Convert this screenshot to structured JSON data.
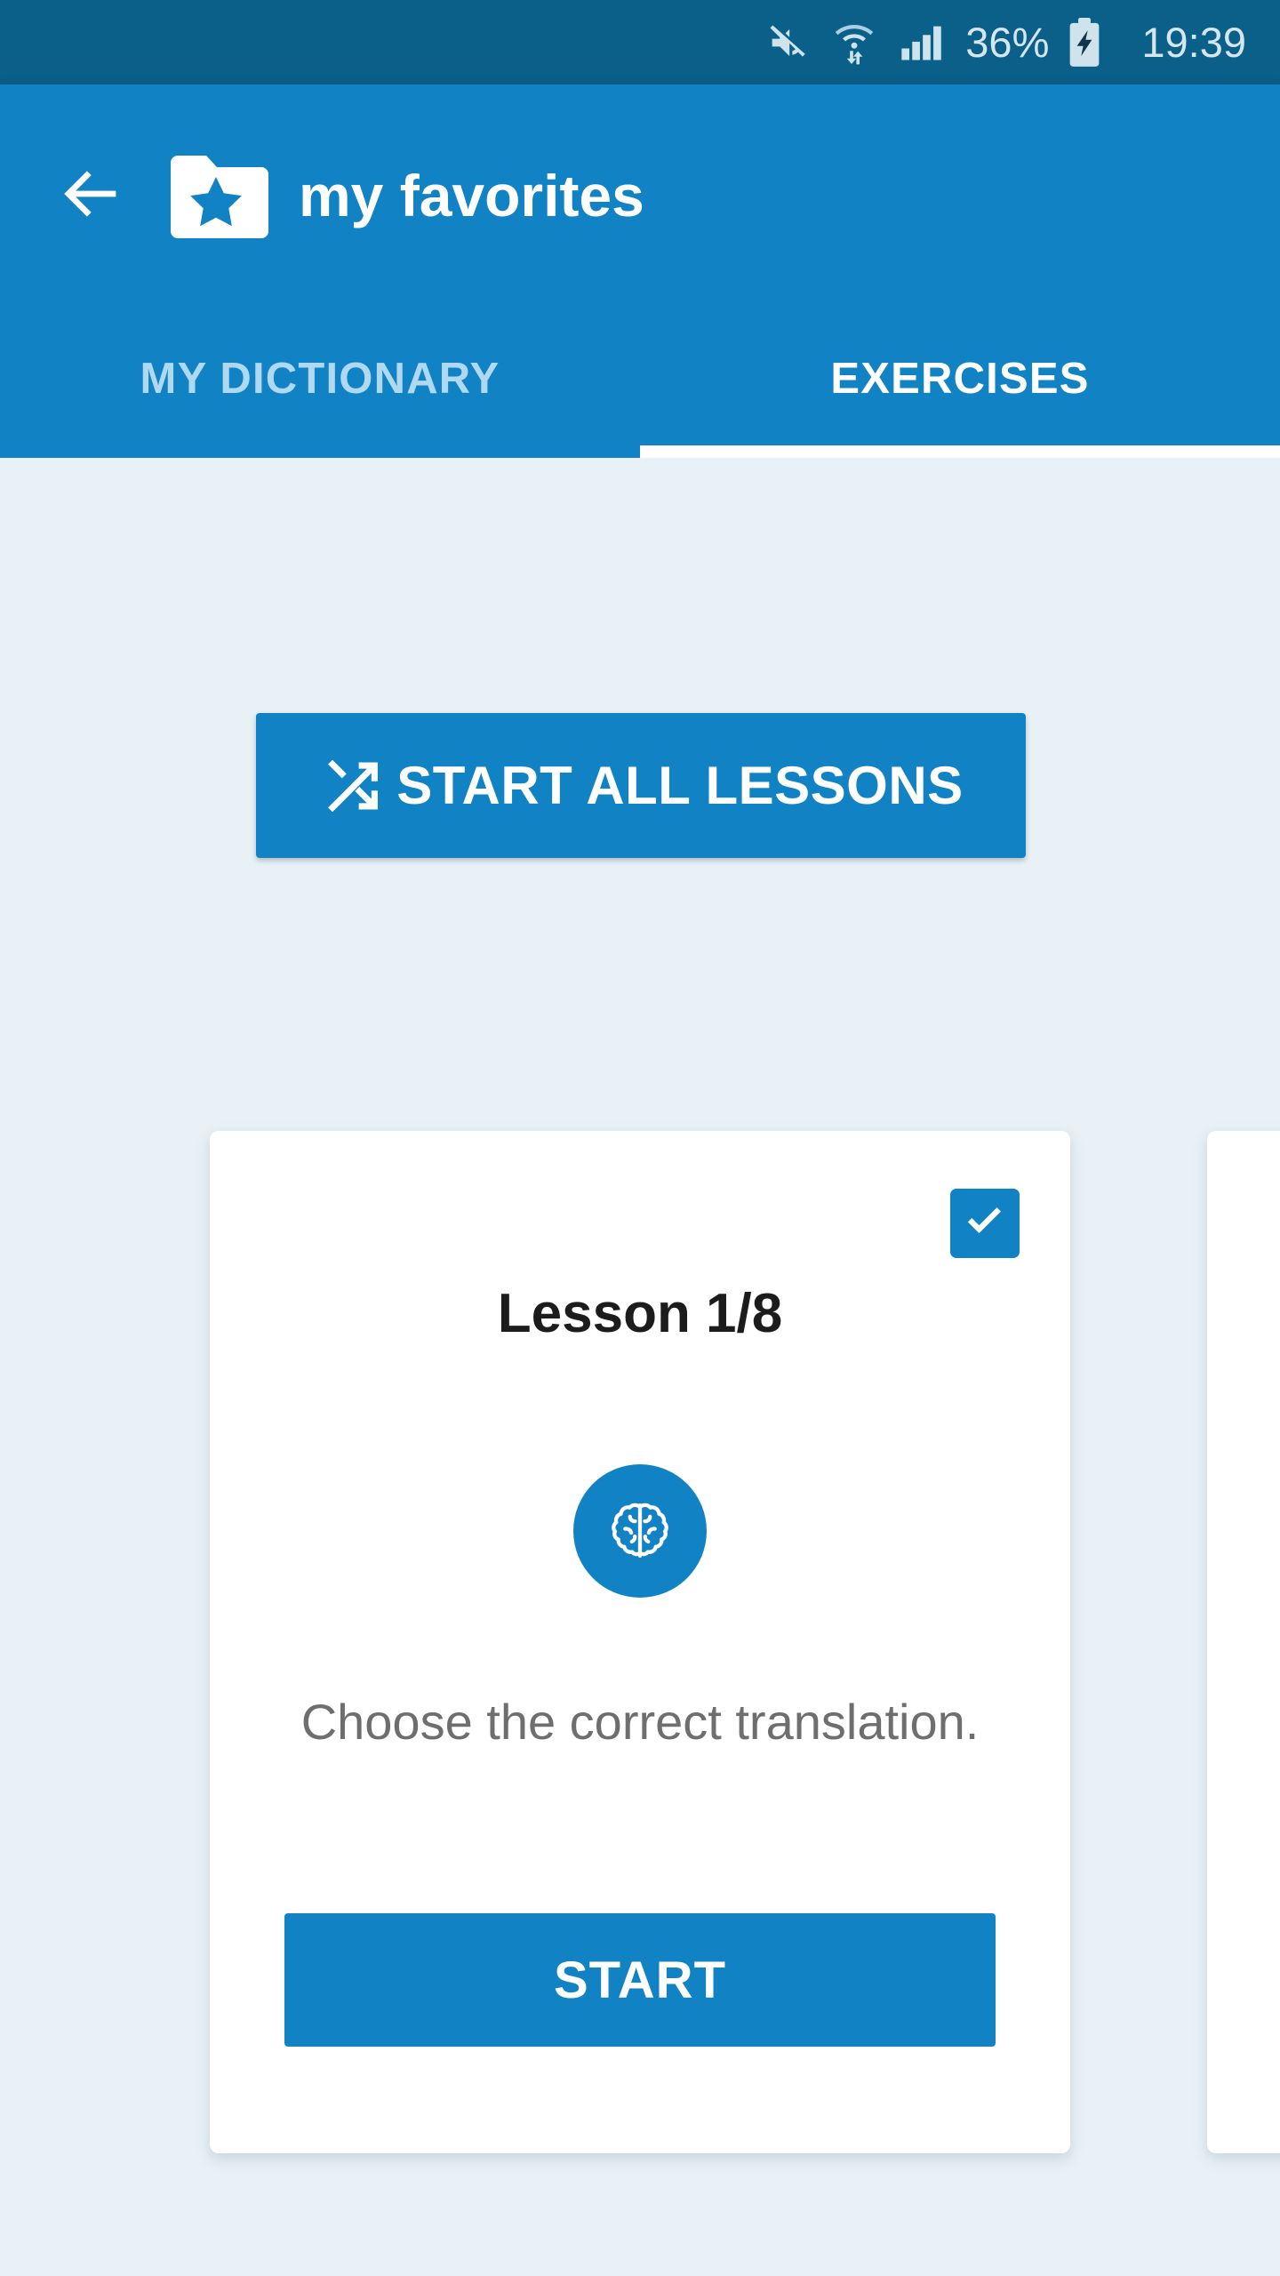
{
  "status_bar": {
    "mute_icon": "mute-icon",
    "wifi_icon": "wifi-transfer-icon",
    "signal_icon": "cellular-signal-icon",
    "battery_percent": "36%",
    "battery_icon": "battery-charging-icon",
    "clock": "19:39",
    "background_color": "#0a6089",
    "text_color": "#d7e6ee"
  },
  "app_bar": {
    "back_icon": "back-arrow-icon",
    "folder_icon": "folder-star-icon",
    "title": "my favorites",
    "background_color": "#1183c4"
  },
  "tabs": [
    {
      "label": "MY DICTIONARY",
      "active": false
    },
    {
      "label": "EXERCISES",
      "active": true
    }
  ],
  "content": {
    "background_color": "#e8f1f6",
    "start_all_lessons": {
      "label": "START ALL LESSONS",
      "icon": "shuffle-icon",
      "color": "#1183c4"
    },
    "cards": [
      {
        "title": "Lesson 1/8",
        "icon": "brain-icon",
        "description": "Choose the correct translation.",
        "start_label": "START",
        "checked": true,
        "accent_color": "#1183c4"
      },
      {
        "title": "",
        "icon": "",
        "description": "",
        "start_label": "",
        "checked": false,
        "accent_color": "#1183c4"
      }
    ]
  }
}
